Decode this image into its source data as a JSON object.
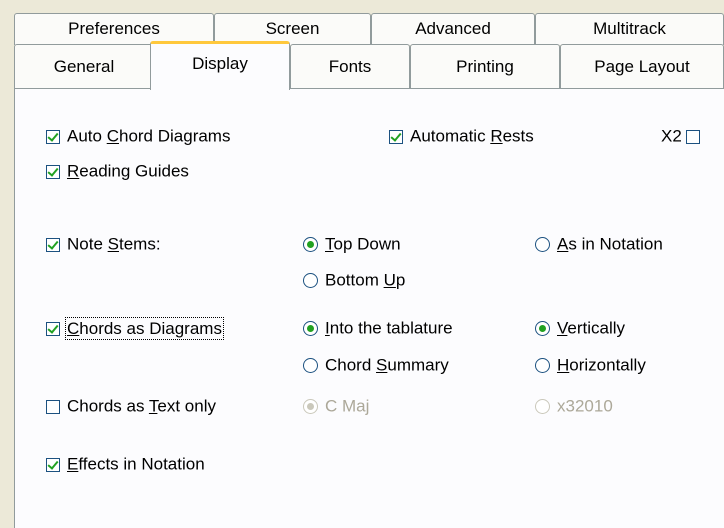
{
  "tabs": {
    "row1": [
      "Preferences",
      "Screen",
      "Advanced",
      "Multitrack"
    ],
    "row2": [
      "General",
      "Display",
      "Fonts",
      "Printing",
      "Page Layout"
    ],
    "active": "Display"
  },
  "options": {
    "auto_chord_diagrams": {
      "pre": "Auto ",
      "key": "C",
      "post": "hord Diagrams",
      "checked": true
    },
    "automatic_rests": {
      "pre": "Automatic ",
      "key": "R",
      "post": "ests",
      "checked": true
    },
    "x2": {
      "label": "X2",
      "checked": false
    },
    "reading_guides": {
      "pre": "",
      "key": "R",
      "post": "eading Guides",
      "checked": true
    },
    "note_stems": {
      "pre": "Note ",
      "key": "S",
      "post": "tems:",
      "checked": true
    },
    "stems_top_down": {
      "pre": "",
      "key": "T",
      "post": "op Down",
      "selected": true
    },
    "stems_as_in_notation": {
      "pre": "",
      "key": "A",
      "post": "s in Notation",
      "selected": false
    },
    "stems_bottom_up": {
      "pre": "Bottom ",
      "key": "U",
      "post": "p",
      "selected": false
    },
    "chords_as_diagrams": {
      "pre": "",
      "key": "C",
      "post": "hords as Diagrams",
      "checked": true
    },
    "into_tablature": {
      "pre": "",
      "key": "I",
      "post": "nto the tablature",
      "selected": true
    },
    "vertically": {
      "pre": "",
      "key": "V",
      "post": "ertically",
      "selected": true
    },
    "chord_summary": {
      "pre": "Chord ",
      "key": "S",
      "post": "ummary",
      "selected": false
    },
    "horizontally": {
      "pre": "",
      "key": "H",
      "post": "orizontally",
      "selected": false
    },
    "chords_as_text": {
      "pre": "Chords as ",
      "key": "T",
      "post": "ext only",
      "checked": false
    },
    "c_maj": {
      "label": "C Maj",
      "selected": true,
      "disabled": true
    },
    "x32010": {
      "label": "x32010",
      "selected": false,
      "disabled": true
    },
    "effects_in_notation": {
      "pre": "",
      "key": "E",
      "post": "ffects in Notation",
      "checked": true
    }
  }
}
